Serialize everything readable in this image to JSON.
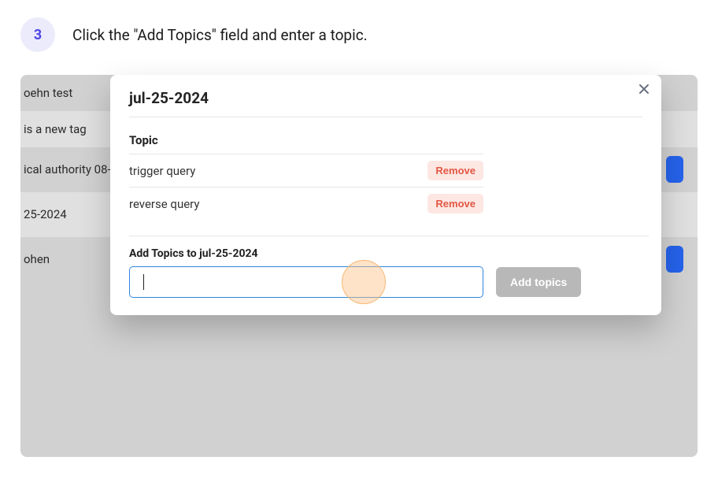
{
  "step": {
    "number": "3",
    "instruction": "Click the \"Add Topics\" field and enter a topic."
  },
  "background_rows": [
    {
      "label": "oehn test"
    },
    {
      "label": " is a new tag"
    },
    {
      "label": "ical authority 08-2",
      "has_chip": true
    },
    {
      "label": "25-2024"
    },
    {
      "label": "ohen",
      "has_chip": true
    }
  ],
  "modal": {
    "title": "jul-25-2024",
    "topic_header": "Topic",
    "topics": [
      {
        "name": "trigger query",
        "action": "Remove"
      },
      {
        "name": "reverse query",
        "action": "Remove"
      }
    ],
    "add_label": "Add Topics to jul-25-2024",
    "input_value": "",
    "add_button": "Add topics"
  }
}
